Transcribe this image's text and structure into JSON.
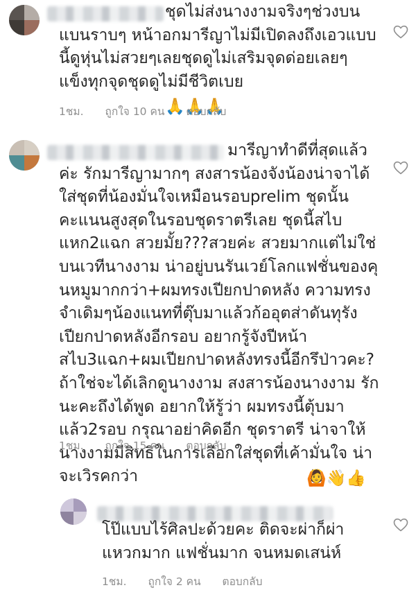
{
  "comments": [
    {
      "text": "ชุดไม่ส่งนางงามจริงๆช่วงบน\nแบนราบๆ หน้าอกมารีญาไม่มีเปิดลงถึงเอวแบบ\nนี้ดูหุ่นไม่สวยๆเลยชุดดูไม่เสริมจุดด่อยเลยๆ\nแข็งทุกจุดชุดดูไม่มีชีวิตเบย",
      "emoji": "🙏🙏🙏",
      "time": "1ชม.",
      "likes": "ถูกใจ 10 คน",
      "reply": "ตอบกลับ"
    },
    {
      "text": "มารีญาทำดีที่สุดแล้ว\nค่ะ รักมารีญามากๆ สงสารน้องจังน้องน่าจาได้\nใส่ชุดที่น้องมั่นใจเหมือนรอบprelim ชุดนั้น\nคะแนนสูงสุดในรอบชุดราตรีเลย ชุดนี้สไบ\nแหก2แฉก สวยมั้ย???สวยค่ะ สวยมากแต่ไม่ใช่\nบนเวทีนางงาม น่าอยู่บนรันเวย์โลกแฟชั่นของคุ\nนหมูมากกว่า+ผมทรงเปียกปาดหลัง ความทรง\nจำเดิมๆน้องแนทที่ตุ๊บมาแล้วก้ออุตส่าดันทุรัง\nเปียกปาดหลังอีกรอบ อยากรู้จังปีหน้า\nสไบ3แฉก+ผมเปียกปาดหลังทรงนี้อีกรึป่าวคะ?\nถ้าใช่จะได้เลิกดูนางงาม สงสารน้องนางงาม รัก\nนะคะถึงได้พูด อยากให้รู้ว่า ผมทรงนี้ตุ้บมา\nแล้ว2รอบ กรุณาอย่าคิดอีก ชุดราตรี น่าจาให้\nนางงามมีสิทธิในการเลือกใส่ชุดที่เค้ามั่นใจ น่า\nจะเวิรคกว่า",
      "emoji": "🙆👋👍",
      "time": "1ชม.",
      "likes": "ถูกใจ 15 คน",
      "reply": "ตอบกลับ"
    },
    {
      "text": "โป๊แบบไร้ศิลปะด้วยคะ ติดจะผ่าก็ผ่า\nแหวกมาก แฟชั่นมาก จนหมดเสน่ห์",
      "emoji": "",
      "time": "1ชม.",
      "likes": "ถูกใจ 2 คน",
      "reply": "ตอบกลับ"
    }
  ],
  "icons": {
    "like": "heart-outline-icon"
  }
}
